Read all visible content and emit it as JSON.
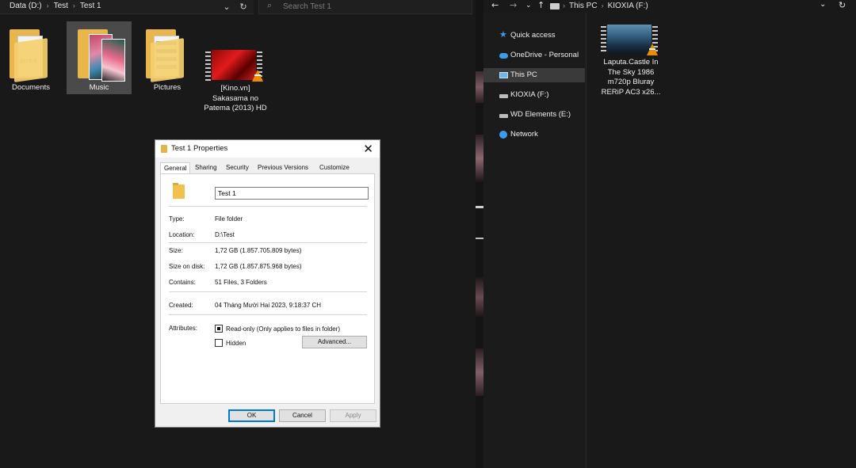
{
  "left_explorer": {
    "breadcrumb": [
      "Data (D:)",
      "Test",
      "Test 1"
    ],
    "search_placeholder": "Search Test 1",
    "items": [
      {
        "label": "Documents",
        "icon": "documents-folder-icon"
      },
      {
        "label": "Music",
        "icon": "music-folder-icon",
        "selected": true
      },
      {
        "label": "Pictures",
        "icon": "pictures-folder-icon"
      },
      {
        "label": "[Kino.vn] Sakasama no Patema (2013) HD",
        "icon": "video-file-icon"
      }
    ]
  },
  "dialog": {
    "title": "Test 1 Properties",
    "tabs": [
      "General",
      "Sharing",
      "Security",
      "Previous Versions",
      "Customize"
    ],
    "active_tab": "General",
    "folder_name": "Test 1",
    "properties": {
      "type_label": "Type:",
      "type_value": "File folder",
      "location_label": "Location:",
      "location_value": "D:\\Test",
      "size_label": "Size:",
      "size_value": "1,72 GB (1.857.705.809 bytes)",
      "size_on_disk_label": "Size on disk:",
      "size_on_disk_value": "1,72 GB (1.857.875.968 bytes)",
      "contains_label": "Contains:",
      "contains_value": "51 Files, 3 Folders",
      "created_label": "Created:",
      "created_value": "04 Tháng Mười Hai 2023, 9:18:37 CH",
      "attributes_label": "Attributes:"
    },
    "attributes": {
      "readonly_label": "Read-only (Only applies to files in folder)",
      "readonly_state": "indeterminate",
      "hidden_label": "Hidden",
      "hidden_checked": false,
      "advanced_label": "Advanced..."
    },
    "buttons": {
      "ok": "OK",
      "cancel": "Cancel",
      "apply": "Apply"
    }
  },
  "right_explorer": {
    "breadcrumb": [
      "This PC",
      "KIOXIA (F:)"
    ],
    "nav_items": [
      {
        "label": "Quick access",
        "icon": "star-icon"
      },
      {
        "label": "OneDrive - Personal",
        "icon": "cloud-icon"
      },
      {
        "label": "This PC",
        "icon": "computer-icon",
        "selected": true
      },
      {
        "label": "KIOXIA (F:)",
        "icon": "drive-icon"
      },
      {
        "label": "WD Elements (E:)",
        "icon": "drive-icon"
      },
      {
        "label": "Network",
        "icon": "network-icon"
      }
    ],
    "file": {
      "label": "Laputa.Castle In The Sky 1986 m720p Bluray RERiP AC3 x26...",
      "icon": "video-file-icon"
    }
  },
  "colors": {
    "accent": "#0078d7",
    "folder": "#f0c24d",
    "background": "#191919",
    "vlc_cone": "#f08a00"
  }
}
